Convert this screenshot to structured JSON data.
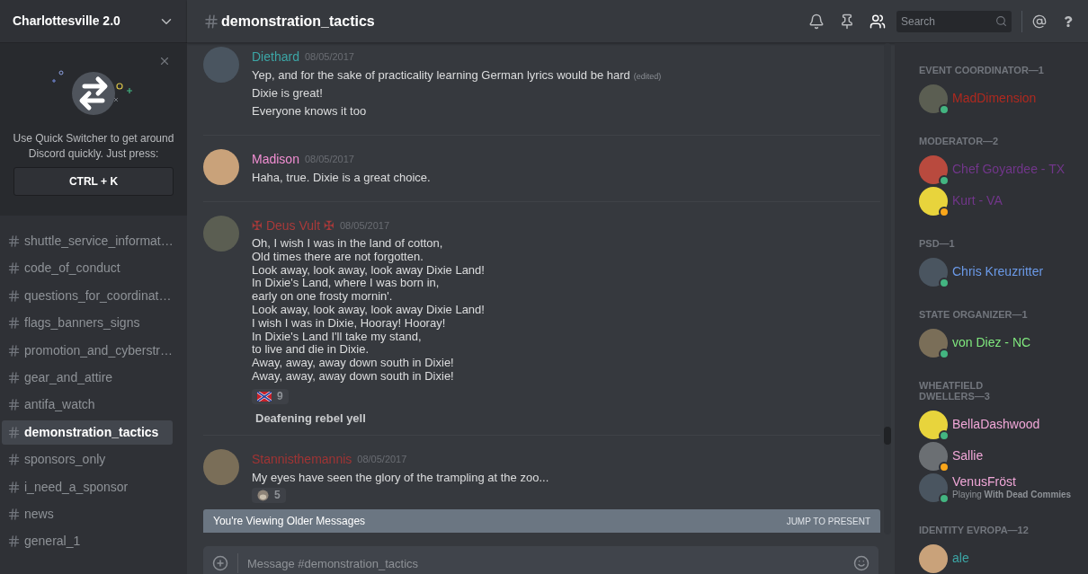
{
  "server": {
    "name": "Charlottesville 2.0"
  },
  "quick_switcher": {
    "text": "Use Quick Switcher to get around Discord quickly. Just press:",
    "shortcut": "CTRL + K"
  },
  "channels": [
    {
      "name": "shuttle_service_informat…",
      "selected": false
    },
    {
      "name": "code_of_conduct",
      "selected": false
    },
    {
      "name": "questions_for_coordinat…",
      "selected": false
    },
    {
      "name": "flags_banners_signs",
      "selected": false
    },
    {
      "name": "promotion_and_cyberstr…",
      "selected": false
    },
    {
      "name": "gear_and_attire",
      "selected": false
    },
    {
      "name": "antifa_watch",
      "selected": false
    },
    {
      "name": "demonstration_tactics",
      "selected": true
    },
    {
      "name": "sponsors_only",
      "selected": false
    },
    {
      "name": "i_need_a_sponsor",
      "selected": false
    },
    {
      "name": "news",
      "selected": false
    },
    {
      "name": "general_1",
      "selected": false
    }
  ],
  "header": {
    "channel": "demonstration_tactics",
    "search_placeholder": "Search"
  },
  "messages": [
    {
      "author": "Diethard",
      "color": "#3ca6a6",
      "timestamp": "08/05/2017",
      "lines": [
        {
          "text": "Yep, and for the sake of practicality learning German lyrics would be hard",
          "edited": "(edited)"
        },
        {
          "text": "Dixie is great!"
        },
        {
          "text": "Everyone knows it too"
        }
      ]
    },
    {
      "author": "Madison",
      "color": "#f28fd3",
      "timestamp": "08/05/2017",
      "lines": [
        {
          "text": "Haha, true. Dixie is a great choice."
        }
      ]
    },
    {
      "author": "✠ Deus Vult ✠",
      "color": "#a83a3a",
      "timestamp": "08/05/2017",
      "lines": [
        {
          "text": "Oh, I wish I was in the land of cotton,\nOld times there are not forgotten.\nLook away, look away, look away Dixie Land!\nIn Dixie's Land, where I was born in,\nearly on one frosty mornin'.\nLook away, look away, look away Dixie Land!\nI wish I was in Dixie, Hooray! Hooray!\nIn Dixie's Land I'll take my stand,\nto live and die in Dixie.\nAway, away, away down south in Dixie!\nAway, away, away down south in Dixie!"
        }
      ],
      "reactions": [
        {
          "kind": "flag",
          "count": "9"
        }
      ],
      "embed": {
        "title": "Deafening rebel yell"
      }
    },
    {
      "author": "Stannisthemannis",
      "color": "#a03434",
      "timestamp": "08/05/2017",
      "lines": [
        {
          "text": "My eyes have seen the glory of the trampling at the zoo..."
        }
      ],
      "reactions": [
        {
          "kind": "ape",
          "count": "5"
        }
      ]
    }
  ],
  "banner": {
    "text": "You're Viewing Older Messages",
    "action": "JUMP TO PRESENT"
  },
  "composer": {
    "placeholder": "Message #demonstration_tactics"
  },
  "member_groups": [
    {
      "title": "EVENT COORDINATOR—1",
      "members": [
        {
          "name": "MadDimension",
          "color": "#b0291f",
          "kind": "online"
        }
      ]
    },
    {
      "title": "MODERATOR—2",
      "members": [
        {
          "name": "Chef Goyardee - TX",
          "color": "#71368a",
          "kind": "online"
        },
        {
          "name": "Kurt - VA",
          "color": "#71368a",
          "kind": "idle"
        }
      ]
    },
    {
      "title": "PSD—1",
      "members": [
        {
          "name": "Chris Kreuzritter",
          "color": "#6b9ae8",
          "kind": "online"
        }
      ]
    },
    {
      "title": "STATE ORGANIZER—1",
      "members": [
        {
          "name": "von Diez - NC",
          "color": "#80e87e",
          "kind": "online"
        }
      ]
    },
    {
      "title": "WHEATFIELD DWELLERS—3",
      "members": [
        {
          "name": "BellaDashwood",
          "color": "#f1a7d8",
          "kind": "online"
        },
        {
          "name": "Sallie",
          "color": "#f1a7d8",
          "kind": "idle"
        },
        {
          "name": "VenusFröst",
          "color": "#f1a7d8",
          "kind": "online",
          "activity": "Playing **With Dead Commies**"
        }
      ]
    },
    {
      "title": "IDENTITY EVROPA—12",
      "members": [
        {
          "name": "ale",
          "color": "#3ca6a6"
        }
      ]
    }
  ]
}
